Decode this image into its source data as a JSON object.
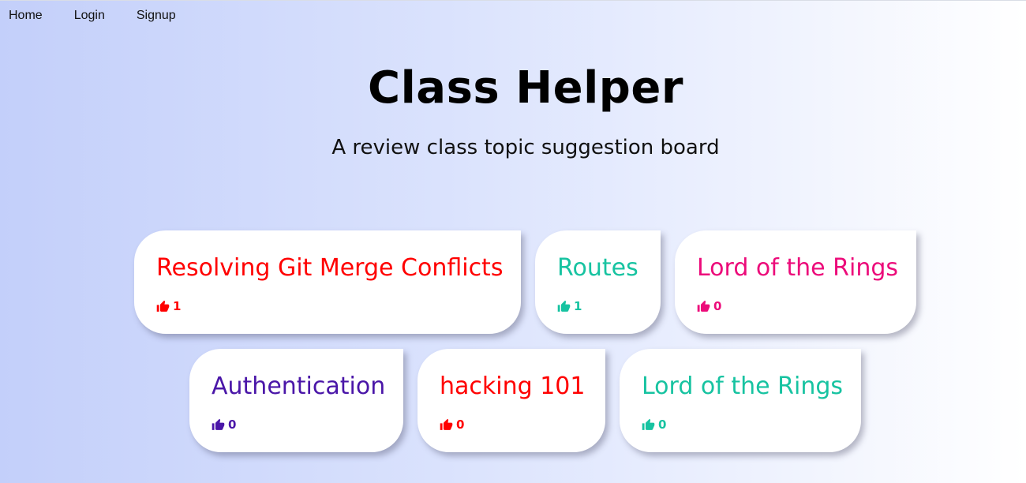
{
  "nav": {
    "items": [
      {
        "label": "Home"
      },
      {
        "label": "Login"
      },
      {
        "label": "Signup"
      }
    ]
  },
  "header": {
    "title": "Class Helper",
    "subtitle": "A review class topic suggestion board"
  },
  "colors": {
    "red": "#ff0000",
    "teal": "#17c3a1",
    "pink": "#ec0b7a",
    "purple": "#4a16a8"
  },
  "cards": [
    {
      "title": "Resolving Git Merge Conflicts",
      "votes": "1",
      "color": "#ff0000",
      "icon": "thumbs-up-icon"
    },
    {
      "title": "Routes",
      "votes": "1",
      "color": "#17c3a1",
      "icon": "thumbs-up-icon"
    },
    {
      "title": "Lord of the Rings",
      "votes": "0",
      "color": "#ec0b7a",
      "icon": "thumbs-up-icon"
    },
    {
      "title": "Authentication",
      "votes": "0",
      "color": "#4a16a8",
      "icon": "thumbs-up-icon"
    },
    {
      "title": "hacking 101",
      "votes": "0",
      "color": "#ff0000",
      "icon": "thumbs-up-icon"
    },
    {
      "title": "Lord of the Rings",
      "votes": "0",
      "color": "#17c3a1",
      "icon": "thumbs-up-icon"
    }
  ]
}
